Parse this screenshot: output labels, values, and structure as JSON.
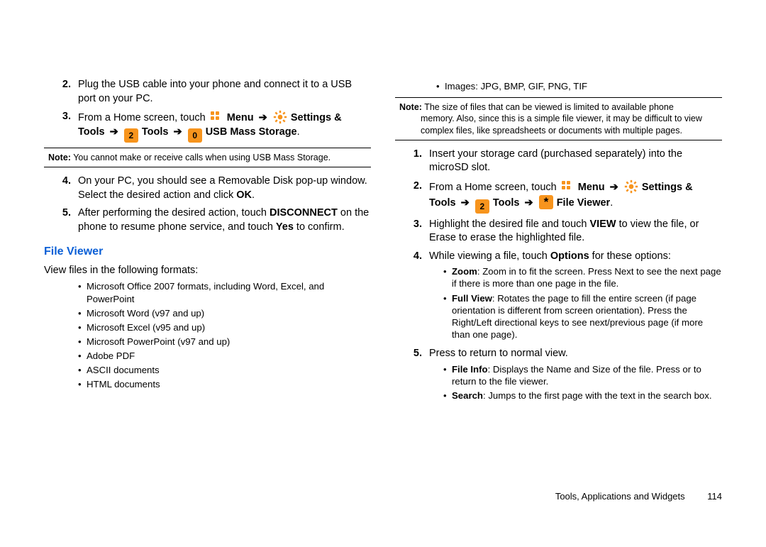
{
  "left": {
    "step2_num": "2.",
    "step2": "Plug the USB cable into your phone and connect it to a USB port on your PC.",
    "step3_num": "3.",
    "step3_a": "From a Home screen, touch ",
    "menu": "Menu",
    "settings_tools": "Settings & Tools",
    "tools": "Tools",
    "usb_mass": "USB Mass Storage",
    "note_lead": "Note:",
    "note_body": "You cannot make or receive calls when using USB Mass Storage.",
    "step4_num": "4.",
    "step4_a": "On your PC, you should see a Removable Disk pop-up window. Select the desired action and click ",
    "ok": "OK",
    "step5_num": "5.",
    "step5_a": "After performing the desired action, touch ",
    "disconnect": "DISCONNECT",
    "step5_b": " on the phone to resume phone service, and touch ",
    "yes": "Yes",
    "step5_c": " to confirm.",
    "h2": "File Viewer",
    "lead": "View files in the following formats:",
    "fmt1": "Microsoft Office 2007 formats, including Word, Excel, and PowerPoint",
    "fmt2": "Microsoft Word (v97 and up)",
    "fmt3": "Microsoft  Excel (v95 and up)",
    "fmt4": "Microsoft  PowerPoint (v97 and up)",
    "fmt5": "Adobe PDF",
    "fmt6": "ASCII documents",
    "fmt7": "HTML documents"
  },
  "right": {
    "img_bullet": "Images: JPG, BMP, GIF, PNG, TIF",
    "note_lead": "Note:",
    "note_body": "The size of files that can be viewed is limited to available phone memory. Also, since this is a simple file viewer, it may be difficult to view complex files, like spreadsheets or documents with multiple pages.",
    "s1_num": "1.",
    "s1": "Insert your storage card (purchased separately) into the microSD slot.",
    "s2_num": "2.",
    "s2_a": "From a Home screen, touch ",
    "menu": "Menu",
    "settings_tools": "Settings & Tools",
    "tools": "Tools",
    "file_viewer": "File Viewer",
    "s3_num": "3.",
    "s3_a": "Highlight the desired file and touch ",
    "view": "VIEW",
    "s3_b": " to view the file, or Erase to erase the highlighted file.",
    "s4_num": "4.",
    "s4_a": "While viewing a file, touch ",
    "options": "Options",
    "s4_b": " for these options:",
    "zoom_l": "Zoom",
    "zoom_t": ": Zoom in to fit the screen. Press Next to see the next page if there is more than one page in the file.",
    "full_l": "Full View",
    "full_t": ": Rotates the page to fill the entire screen (if page orientation is different from screen orientation). Press the Right/Left directional keys to see next/previous page (if more than one page).",
    "s5_num": "5.",
    "s5": "Press to return to normal view.",
    "fileinfo_l": "File Info",
    "fileinfo_t": ": Displays the Name and Size of the file. Press or to return to the file viewer.",
    "search_l": " Search",
    "search_t": ": Jumps to the first page with the text  in the search box."
  },
  "footer": {
    "section": "Tools, Applications and Widgets",
    "page": "114"
  }
}
